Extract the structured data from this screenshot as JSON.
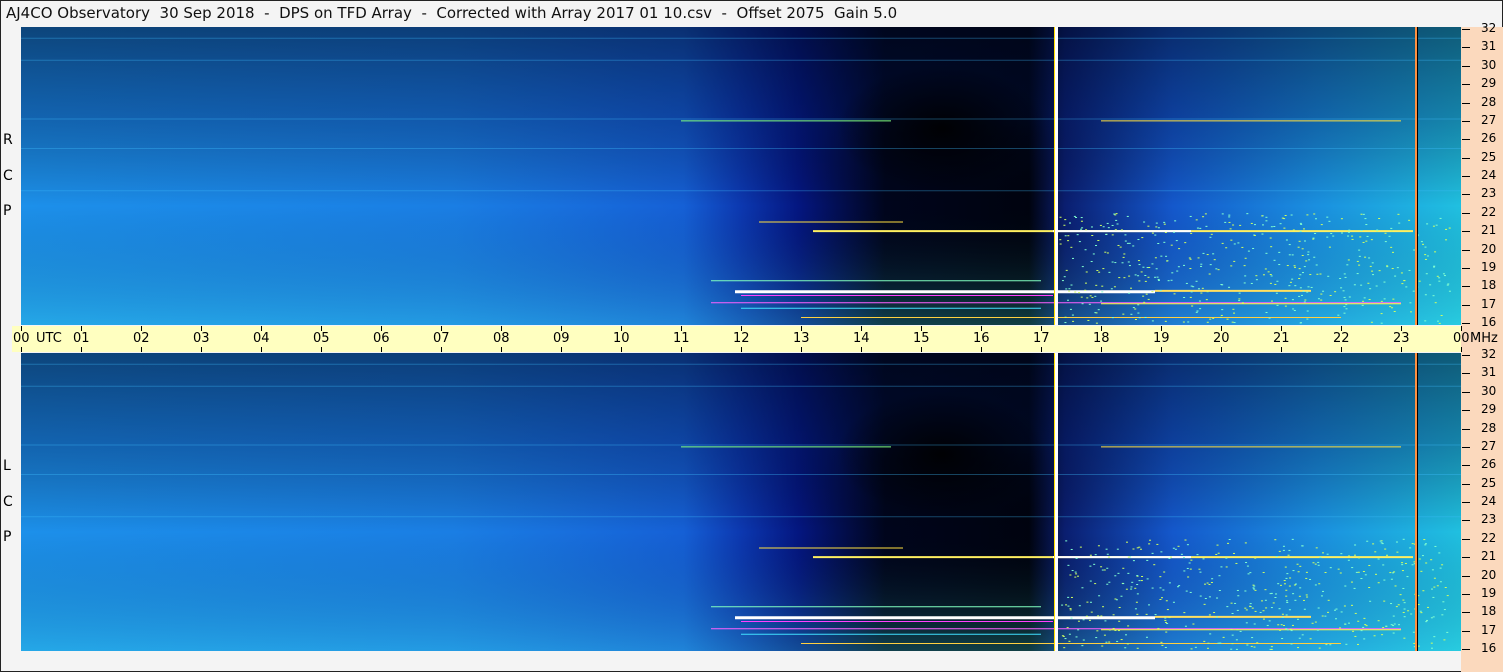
{
  "title": "AJ4CO Observatory  30 Sep 2018  -  DPS on TFD Array  -  Corrected with Array 2017 01 10.csv  -  Offset 2075  Gain 5.0",
  "chart_data": {
    "type": "heatmap",
    "title": "AJ4CO Observatory  30 Sep 2018  -  DPS on TFD Array  -  Corrected with Array 2017 01 10.csv  -  Offset 2075  Gain 5.0",
    "xlabel": "UTC",
    "ylabel": "MHz",
    "x_ticks": [
      "00",
      "01",
      "02",
      "03",
      "04",
      "05",
      "06",
      "07",
      "08",
      "09",
      "10",
      "11",
      "12",
      "13",
      "14",
      "15",
      "16",
      "17",
      "18",
      "19",
      "20",
      "21",
      "22",
      "23",
      "00"
    ],
    "xlim_hours": [
      0,
      24
    ],
    "y_ticks": [
      "32",
      "31",
      "30",
      "29",
      "28",
      "27",
      "26",
      "25",
      "24",
      "23",
      "22",
      "21",
      "20",
      "19",
      "18",
      "17",
      "16"
    ],
    "ylim_mhz": [
      16,
      32
    ],
    "panels": [
      {
        "name": "RCP",
        "label_letters": [
          "R",
          "C",
          "P"
        ]
      },
      {
        "name": "LCP",
        "label_letters": [
          "L",
          "C",
          "P"
        ]
      }
    ],
    "features": {
      "dark_period_hours": [
        12.5,
        17.5
      ],
      "strong_emission_bands_mhz": [
        17.0,
        17.7,
        21.0,
        21.5,
        27.0
      ],
      "vertical_markers_hours": [
        17.25,
        23.25
      ]
    }
  },
  "axis": {
    "utc_label": "UTC",
    "mhz_label": "MHz"
  }
}
